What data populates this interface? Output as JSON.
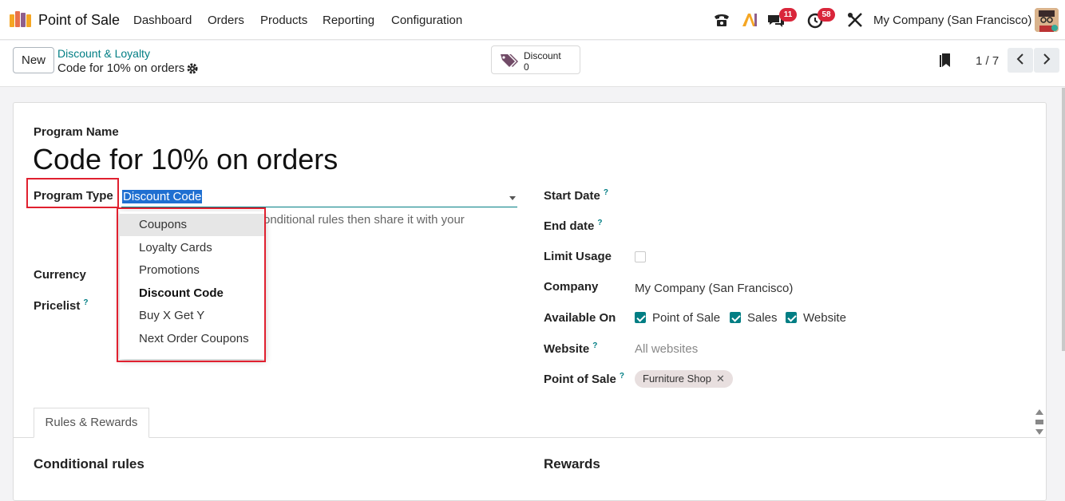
{
  "navbar": {
    "app_name": "Point of Sale",
    "menu": [
      "Dashboard",
      "Orders",
      "Products",
      "Reporting",
      "Configuration"
    ],
    "messages_badge": "11",
    "activities_badge": "58",
    "company": "My Company (San Francisco)"
  },
  "control_panel": {
    "new_label": "New",
    "breadcrumb_parent": "Discount & Loyalty",
    "breadcrumb_current": "Code for 10% on orders",
    "smart_button": {
      "label": "Discount",
      "value": "0"
    },
    "pager": "1 / 7"
  },
  "form": {
    "program_name_label": "Program Name",
    "program_name": "Code for 10% on orders",
    "program_type_label": "Program Type",
    "program_type_value": "Discount Code",
    "description_fragment": "onditional rules then share it with your",
    "currency_label": "Currency",
    "pricelist_label": "Pricelist",
    "program_type_options": [
      "Coupons",
      "Loyalty Cards",
      "Promotions",
      "Discount Code",
      "Buy X Get Y",
      "Next Order Coupons"
    ],
    "selected_option": "Discount Code",
    "hovered_option": "Coupons",
    "start_date_label": "Start Date",
    "end_date_label": "End date",
    "limit_usage_label": "Limit Usage",
    "limit_usage": false,
    "company_label": "Company",
    "company_value": "My Company (San Francisco)",
    "available_on_label": "Available On",
    "available_on": [
      {
        "label": "Point of Sale",
        "checked": true
      },
      {
        "label": "Sales",
        "checked": true
      },
      {
        "label": "Website",
        "checked": true
      }
    ],
    "website_label": "Website",
    "website_placeholder": "All websites",
    "pos_label": "Point of Sale",
    "pos_tag": "Furniture Shop",
    "help_mark": "?",
    "tag_remove": "✕"
  },
  "tabs": {
    "rules_rewards": "Rules & Rewards"
  },
  "sections": {
    "conditional_rules": "Conditional rules",
    "rewards": "Rewards"
  },
  "colors": {
    "accent": "#017e84",
    "brand": "#714b67",
    "highlight": "#e0202f",
    "selection": "#1f6fd1"
  }
}
